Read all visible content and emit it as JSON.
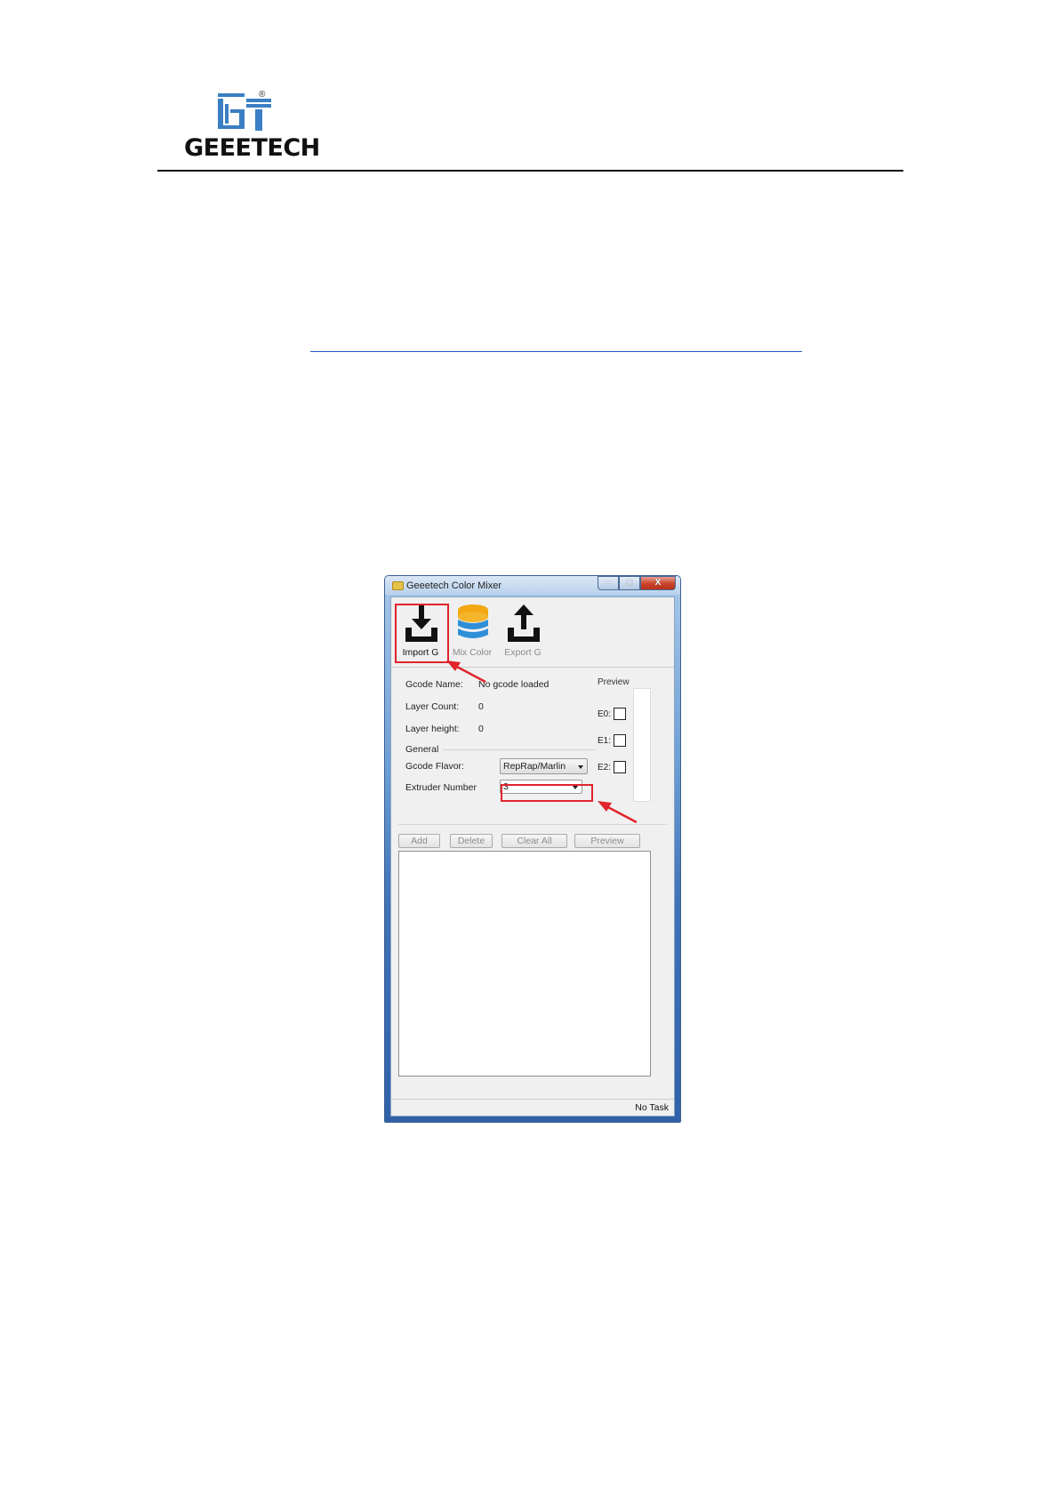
{
  "page": {
    "brand": {
      "wordmark": "GEEETECH",
      "registered": "®"
    }
  },
  "window": {
    "title": "Geeetech Color Mixer",
    "caption_buttons": {
      "minimize": "–",
      "maximize": "□",
      "close": "X"
    },
    "toolbar": [
      {
        "label": "Import G",
        "icon": "download-icon",
        "enabled": true,
        "highlighted": true
      },
      {
        "label": "Mix Color",
        "icon": "database-icon",
        "enabled": false
      },
      {
        "label": "Export G",
        "icon": "upload-icon",
        "enabled": false
      }
    ],
    "info": {
      "gcode_name_label": "Gcode Name:",
      "gcode_name_value": "No gcode loaded",
      "layer_count_label": "Layer Count:",
      "layer_count_value": "0",
      "layer_height_label": "Layer height:",
      "layer_height_value": "0",
      "general_label": "General",
      "gcode_flavor_label": "Gcode Flavor:",
      "gcode_flavor_value": "RepRap/Marlin",
      "extruder_number_label": "Extruder Number",
      "extruder_number_value": "3"
    },
    "preview": {
      "title": "Preview",
      "extruders": [
        "E0:",
        "E1:",
        "E2:"
      ]
    },
    "actions": {
      "add": "Add",
      "delete": "Delete",
      "clear_all": "Clear All",
      "preview": "Preview"
    },
    "status": "No Task"
  },
  "colors": {
    "highlight": "#e0242b",
    "logo_blue": "#3a7fc4"
  }
}
